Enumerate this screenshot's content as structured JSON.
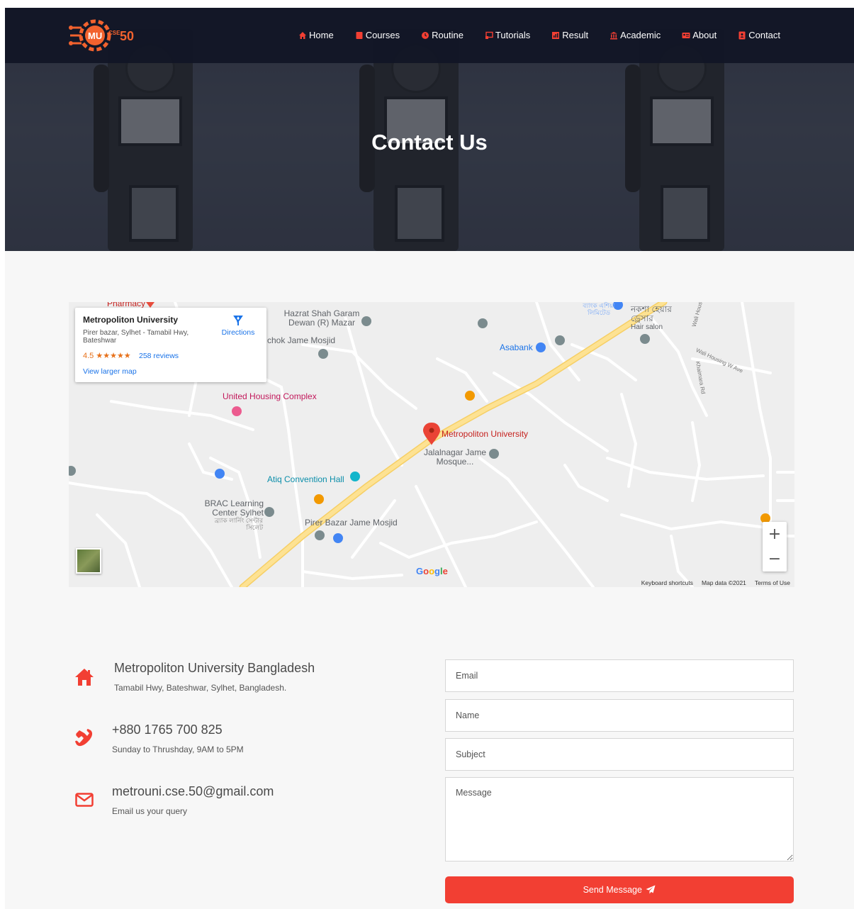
{
  "nav": {
    "logo_text": "MU CSE 50",
    "items": [
      {
        "label": "Home",
        "icon": "home-icon"
      },
      {
        "label": "Courses",
        "icon": "book-icon"
      },
      {
        "label": "Routine",
        "icon": "clock-icon"
      },
      {
        "label": "Tutorials",
        "icon": "video-icon"
      },
      {
        "label": "Result",
        "icon": "chart-icon"
      },
      {
        "label": "Academic",
        "icon": "university-icon"
      },
      {
        "label": "About",
        "icon": "id-card-icon"
      },
      {
        "label": "Contact",
        "icon": "contact-icon"
      }
    ]
  },
  "hero": {
    "title": "Contact Us"
  },
  "map": {
    "place_name": "Metropoliton University",
    "address": "Pirer bazar, Sylhet - Tamabil Hwy, Bateshwar",
    "rating": "4.5",
    "stars": "★★★★★",
    "reviews": "258 reviews",
    "view_larger": "View larger map",
    "directions": "Directions",
    "labels": {
      "pharmacy": "Pharmacy",
      "hazrat": "Hazrat Shah Garam Dewan (R) Mazar",
      "chok": "chok Jame Mosjid",
      "asabank": "Asabank",
      "bank_bn": "ব্যাংক এশিয়া লিমিটেড",
      "naksha": "নকশা হেয়ার ড্রেসার",
      "hair_salon": "Hair salon",
      "wali": "Wali Housi",
      "wali_w": "Wali Housing W Ave",
      "khaimara": "Khaimara Rd",
      "united": "United Housing Complex",
      "metro": "Metropoliton University",
      "jalalnagar": "Jalalnagar Jame Mosque...",
      "atiq": "Atiq Convention Hall",
      "brac": "BRAC Learning Center Sylhet",
      "brac_bn": "ব্র্যাক লার্নিং সেন্টার সিলেট",
      "pirer": "Pirer Bazar Jame Mosjid"
    },
    "zoom_in": "+",
    "zoom_out": "−",
    "google": "Google",
    "attribution": [
      "Keyboard shortcuts",
      "Map data ©2021",
      "Terms of Use"
    ]
  },
  "contact": {
    "address_title": "Metropoliton University Bangladesh",
    "address_sub": "Tamabil Hwy, Bateshwar, Sylhet, Bangladesh.",
    "phone_title": "+880 1765 700 825",
    "phone_sub": "Sunday to Thrushday, 9AM to 5PM",
    "email_title": "metrouni.cse.50@gmail.com",
    "email_sub": "Email us your query"
  },
  "form": {
    "email_placeholder": "Email",
    "name_placeholder": "Name",
    "subject_placeholder": "Subject",
    "message_placeholder": "Message",
    "send_label": "Send Message"
  },
  "colors": {
    "accent": "#f23f33",
    "nav_bg": "#111526"
  }
}
